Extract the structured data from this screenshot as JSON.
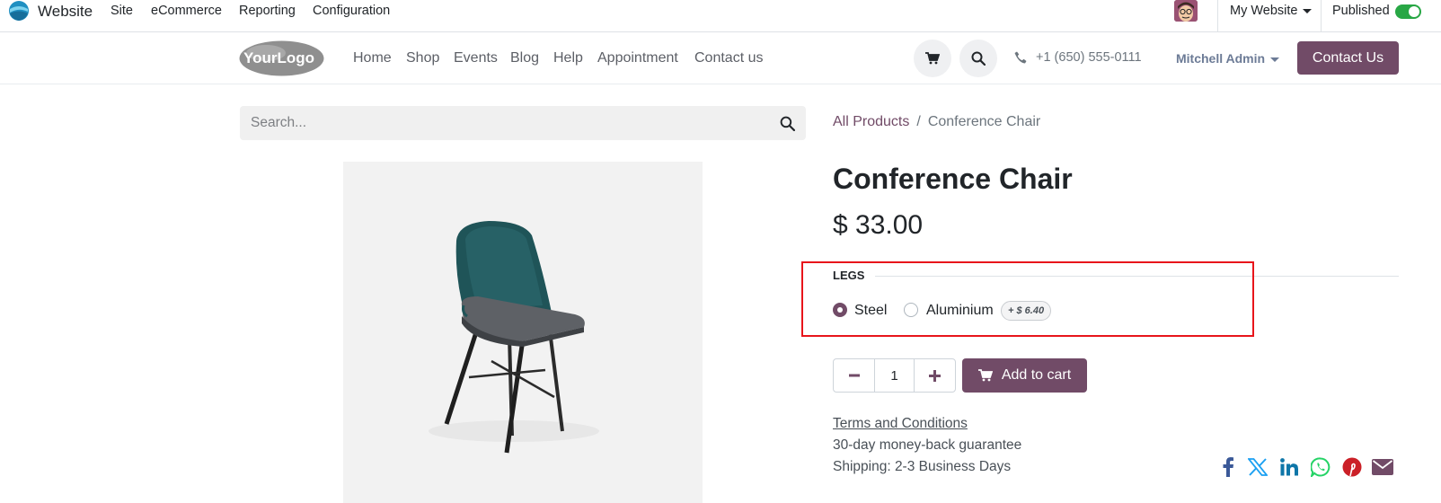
{
  "admin_bar": {
    "app_name": "Website",
    "menu": [
      "Site",
      "eCommerce",
      "Reporting",
      "Configuration"
    ],
    "website_selector": "My Website",
    "published_label": "Published",
    "published": true
  },
  "header": {
    "logo_text": "YourLogo",
    "nav": [
      "Home",
      "Shop",
      "Events",
      "Blog",
      "Help",
      "Appointment",
      "Contact us"
    ],
    "phone": "+1 (650) 555-0111",
    "user": "Mitchell Admin",
    "cta": "Contact Us"
  },
  "search": {
    "placeholder": "Search..."
  },
  "breadcrumb": {
    "parent": "All Products",
    "separator": "/",
    "current": "Conference Chair"
  },
  "product": {
    "name": "Conference Chair",
    "price": "$ 33.00",
    "attribute": {
      "name": "LEGS",
      "options": [
        {
          "label": "Steel",
          "selected": true
        },
        {
          "label": "Aluminium",
          "selected": false,
          "extra": "+ $ 6.40"
        }
      ]
    },
    "quantity": "1",
    "add_to_cart": "Add to cart",
    "terms": "Terms and Conditions",
    "guarantee": "30-day money-back guarantee",
    "shipping": "Shipping: 2-3 Business Days"
  },
  "colors": {
    "brand": "#714b67",
    "highlight": "#e8151b",
    "toggle_on": "#28a745"
  },
  "share_icons": [
    "facebook-icon",
    "x-twitter-icon",
    "linkedin-icon",
    "whatsapp-icon",
    "pinterest-icon",
    "email-icon"
  ]
}
